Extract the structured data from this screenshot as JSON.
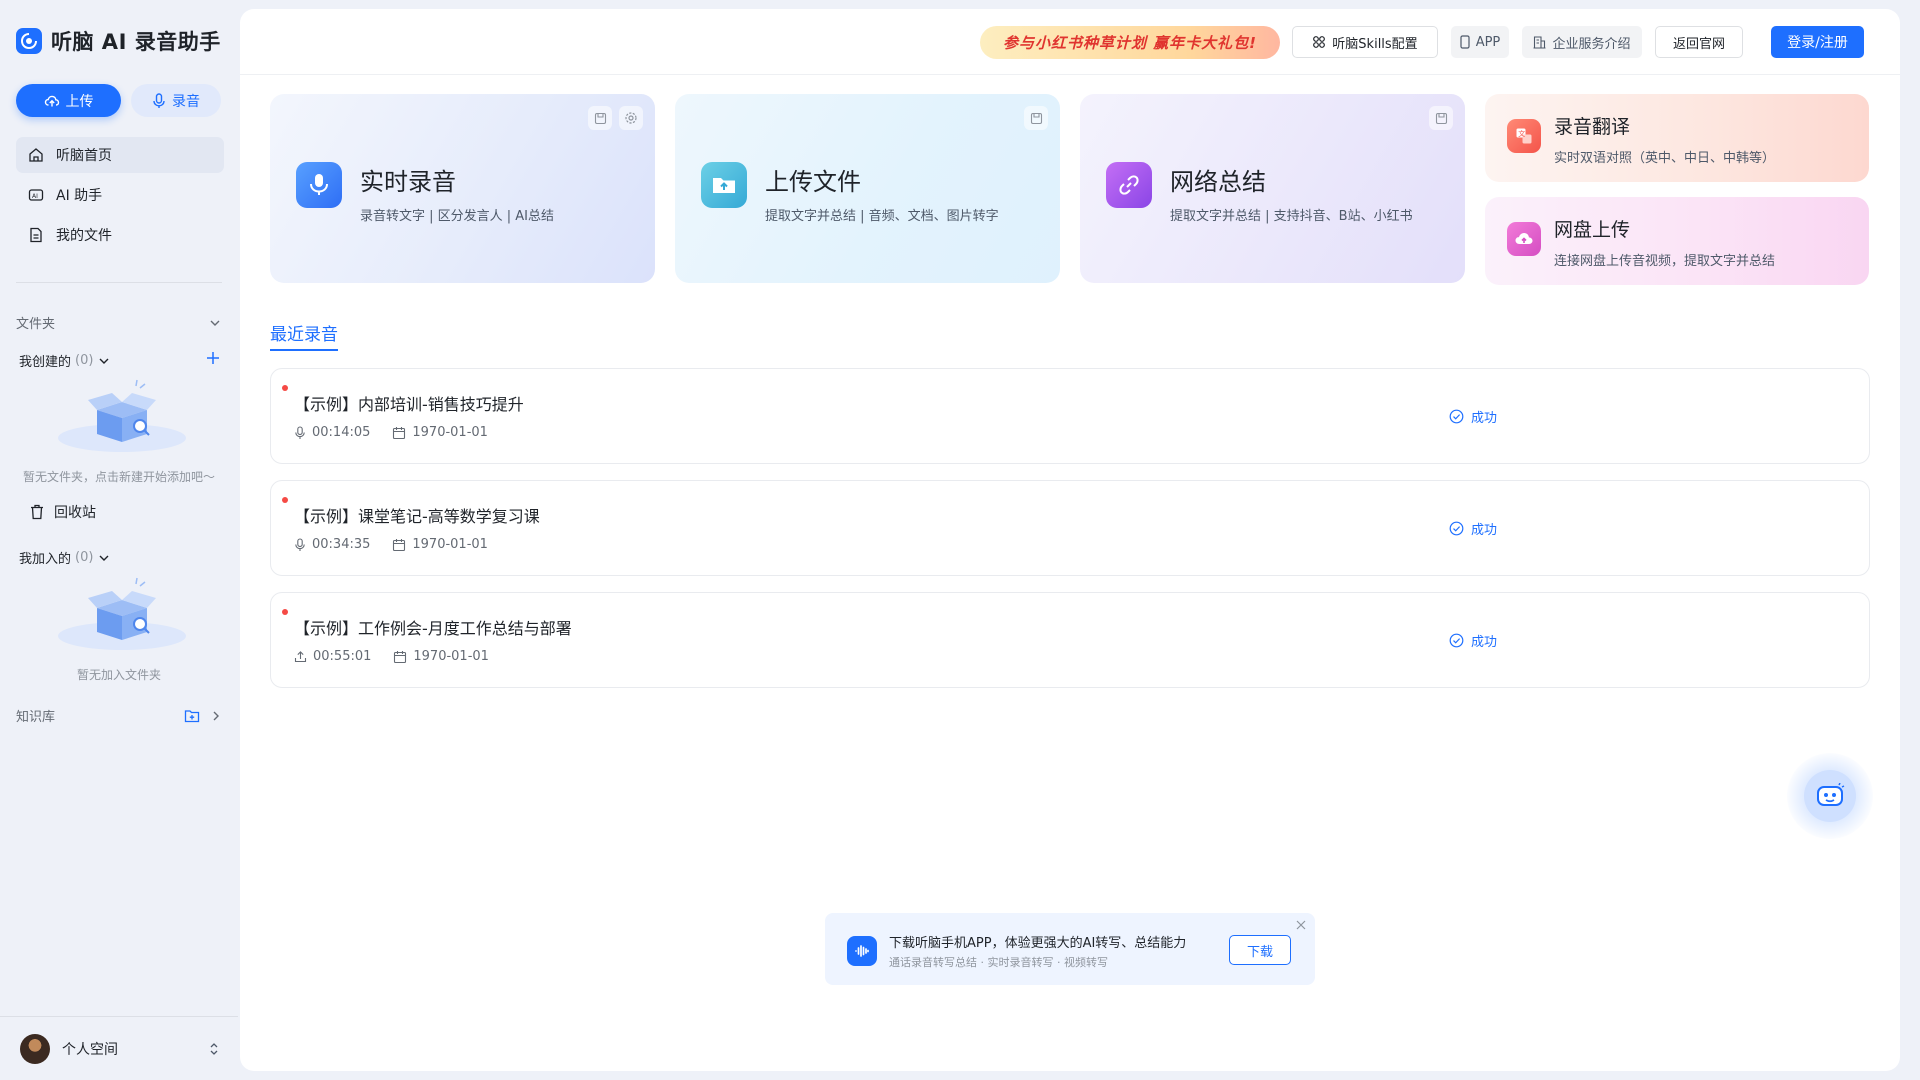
{
  "brand": {
    "name": "听脑 AI 录音助手"
  },
  "sidebar": {
    "upload_label": "上传",
    "record_label": "录音",
    "nav": [
      {
        "label": "听脑首页",
        "icon": "home-icon"
      },
      {
        "label": "AI 助手",
        "icon": "ai-assistant-icon"
      },
      {
        "label": "我的文件",
        "icon": "file-icon"
      }
    ],
    "folders_title": "文件夹",
    "created": {
      "label": "我创建的",
      "count": "(0)",
      "empty": "暂无文件夹，点击新建开始添加吧～"
    },
    "recycle_label": "回收站",
    "joined": {
      "label": "我加入的",
      "count": "(0)",
      "empty": "暂无加入文件夹"
    },
    "knowledge_title": "知识库",
    "user": {
      "name": "个人空间"
    }
  },
  "header": {
    "promo": "参与小红书种草计划 赢年卡大礼包!",
    "skills_config": "听脑Skills配置",
    "app": "APP",
    "enterprise": "企业服务介绍",
    "back_site": "返回官网",
    "login": "登录/注册"
  },
  "cards": [
    {
      "title": "实时录音",
      "desc": "录音转文字 | 区分发言人 | AI总结",
      "icon": "microphone-icon"
    },
    {
      "title": "上传文件",
      "desc": "提取文字并总结 | 音频、文档、图片转字",
      "icon": "upload-folder-icon"
    },
    {
      "title": "网络总结",
      "desc": "提取文字并总结 | 支持抖音、B站、小红书",
      "icon": "link-icon"
    }
  ],
  "mini_cards": [
    {
      "title": "录音翻译",
      "desc": "实时双语对照（英中、中日、中韩等）",
      "icon": "translate-icon"
    },
    {
      "title": "网盘上传",
      "desc": "连接网盘上传音视频，提取文字并总结",
      "icon": "cloud-upload-icon"
    }
  ],
  "recent": {
    "tab_label": "最近录音",
    "items": [
      {
        "title": "【示例】内部培训-销售技巧提升",
        "duration": "00:14:05",
        "date": "1970-01-01",
        "status": "成功",
        "source_icon": "microphone-icon"
      },
      {
        "title": "【示例】课堂笔记-高等数学复习课",
        "duration": "00:34:35",
        "date": "1970-01-01",
        "status": "成功",
        "source_icon": "microphone-icon"
      },
      {
        "title": "【示例】工作例会-月度工作总结与部署",
        "duration": "00:55:01",
        "date": "1970-01-01",
        "status": "成功",
        "source_icon": "upload-icon"
      }
    ]
  },
  "toast": {
    "title": "下载听脑手机APP，体验更强大的AI转写、总结能力",
    "subtitle": "通话录音转写总结 · 实时录音转写 · 视频转写",
    "button": "下载"
  },
  "colors": {
    "accent": "#1e6fff",
    "danger_dot": "#f54a45",
    "sidebar_bg": "#eef1f8"
  }
}
